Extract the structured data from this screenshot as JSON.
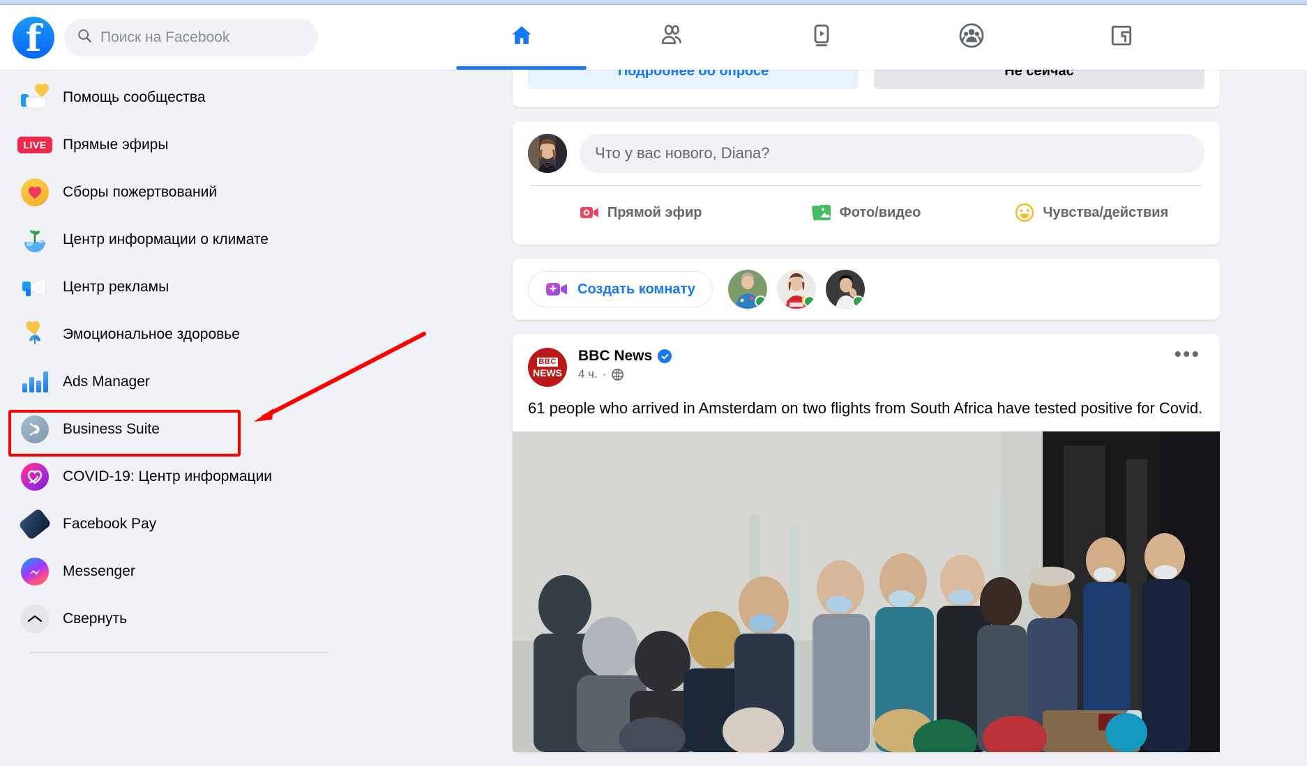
{
  "header": {
    "search_placeholder": "Поиск на Facebook",
    "logo_letter": "f",
    "nav": [
      {
        "name": "home",
        "icon": "home-icon",
        "active": true
      },
      {
        "name": "friends",
        "icon": "friends-icon",
        "active": false
      },
      {
        "name": "watch",
        "icon": "watch-icon",
        "active": false
      },
      {
        "name": "groups",
        "icon": "groups-icon",
        "active": false
      },
      {
        "name": "gaming",
        "icon": "gaming-icon",
        "active": false
      }
    ]
  },
  "sidebar": {
    "items": [
      {
        "label": "Помощь сообщества",
        "icon": "community-help-icon"
      },
      {
        "label": "Прямые эфиры",
        "icon": "live-icon",
        "badge": "LIVE"
      },
      {
        "label": "Сборы пожертвований",
        "icon": "fundraisers-icon"
      },
      {
        "label": "Центр информации о климате",
        "icon": "climate-icon"
      },
      {
        "label": "Центр рекламы",
        "icon": "ad-center-icon"
      },
      {
        "label": "Эмоциональное здоровье",
        "icon": "emotional-health-icon"
      },
      {
        "label": "Ads Manager",
        "icon": "ads-manager-icon",
        "highlighted": true
      },
      {
        "label": "Business Suite",
        "icon": "business-suite-icon"
      },
      {
        "label": "COVID-19: Центр информации",
        "icon": "covid-icon"
      },
      {
        "label": "Facebook Pay",
        "icon": "facebook-pay-icon"
      },
      {
        "label": "Messenger",
        "icon": "messenger-icon"
      },
      {
        "label": "Свернуть",
        "icon": "chevron-up-icon"
      }
    ]
  },
  "annotation": {
    "highlight_color": "#ff0000",
    "target_label": "Ads Manager"
  },
  "feed": {
    "survey": {
      "primary_label": "Подробнее об опросе",
      "secondary_label": "Не сейчас"
    },
    "composer": {
      "placeholder": "Что у вас нового, Diana?",
      "actions": [
        {
          "label": "Прямой эфир",
          "icon": "live-video-icon",
          "color": "#f3425f"
        },
        {
          "label": "Фото/видео",
          "icon": "photo-video-icon",
          "color": "#45bd62"
        },
        {
          "label": "Чувства/действия",
          "icon": "feeling-icon",
          "color": "#f7b928"
        }
      ]
    },
    "rooms": {
      "create_label": "Создать комнату",
      "icon": "video-room-icon",
      "avatars": [
        {
          "name": "room-avatar-1",
          "status": "online"
        },
        {
          "name": "room-avatar-2",
          "status": "online"
        },
        {
          "name": "room-avatar-3",
          "status": "online"
        }
      ]
    },
    "post": {
      "author": "BBC News",
      "verified": true,
      "logo_line1": "BBC",
      "logo_line2": "NEWS",
      "time": "4 ч.",
      "privacy_icon": "globe-icon",
      "menu_icon": "more-options-icon",
      "menu_glyph": "•••",
      "text": "61 people who arrived in Amsterdam on two flights from South Africa have tested positive for Covid.",
      "photo_alt": "airport-queue-photo"
    }
  }
}
